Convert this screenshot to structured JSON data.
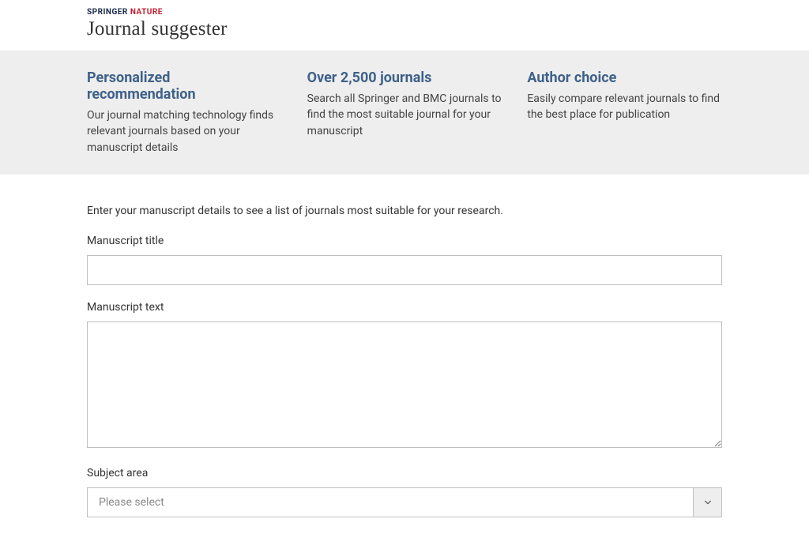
{
  "brand": {
    "part1": "SPRINGER",
    "part2": " NATURE"
  },
  "app_title": "Journal suggester",
  "features": [
    {
      "title": "Personalized recommendation",
      "text": "Our journal matching technology finds relevant journals based on your manuscript details"
    },
    {
      "title": "Over 2,500 journals",
      "text": "Search all Springer and BMC journals to find the most suitable journal for your manuscript"
    },
    {
      "title": "Author choice",
      "text": "Easily compare relevant journals to find the best place for publication"
    }
  ],
  "form": {
    "intro": "Enter your manuscript details to see a list of journals most suitable for your research.",
    "title_label": "Manuscript title",
    "title_value": "",
    "text_label": "Manuscript text",
    "text_value": "",
    "subject_label": "Subject area",
    "subject_placeholder": "Please select"
  }
}
